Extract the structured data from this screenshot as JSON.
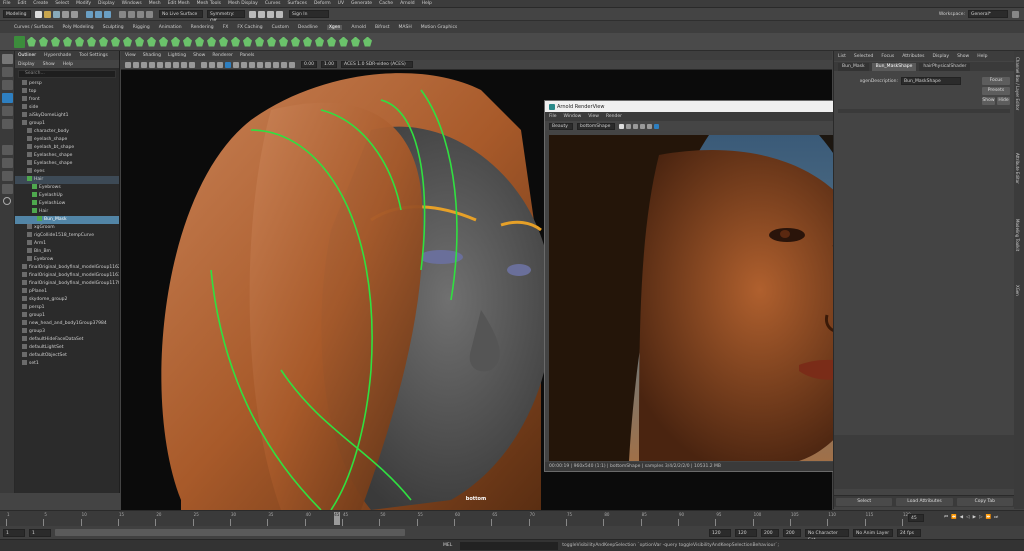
{
  "menubar": {
    "items": [
      "File",
      "Edit",
      "Create",
      "Select",
      "Modify",
      "Display",
      "Windows",
      "Mesh",
      "Edit Mesh",
      "Mesh Tools",
      "Mesh Display",
      "Curves",
      "Surfaces",
      "Deform",
      "UV",
      "Generate",
      "Cache",
      "Arnold",
      "Help"
    ],
    "workspace_label": "Workspace:",
    "workspace_value": "General*"
  },
  "statusline": {
    "mode": "Modeling",
    "live_surface": "No Live Surface",
    "symmetry": "Symmetry: Off",
    "sign_in": "Sign In"
  },
  "shelf": {
    "tabs": [
      "Curves / Surfaces",
      "Poly Modeling",
      "Sculpting",
      "Rigging",
      "Animation",
      "Rendering",
      "FX",
      "FX Caching",
      "Custom",
      "Deadline",
      "Xgen",
      "Arnold",
      "Bifrost",
      "MASH",
      "Motion Graphics"
    ],
    "active_tab": "Xgen"
  },
  "outliner": {
    "tabs": [
      "Outliner",
      "Hypershade",
      "Tool Settings"
    ],
    "menu": [
      "Display",
      "Show",
      "Help"
    ],
    "search_placeholder": "Search...",
    "items": [
      {
        "label": "persp",
        "indent": 1
      },
      {
        "label": "top",
        "indent": 1
      },
      {
        "label": "front",
        "indent": 1
      },
      {
        "label": "side",
        "indent": 1
      },
      {
        "label": "aiSkyDomeLight1",
        "indent": 1
      },
      {
        "label": "group1",
        "indent": 1
      },
      {
        "label": "character_body",
        "indent": 2
      },
      {
        "label": "eyelash_shape",
        "indent": 2
      },
      {
        "label": "eyelash_bt_shape",
        "indent": 2
      },
      {
        "label": "Eyelashes_shape",
        "indent": 2
      },
      {
        "label": "Eyelashes_shape",
        "indent": 2
      },
      {
        "label": "eyes",
        "indent": 2
      },
      {
        "label": "Hair",
        "indent": 2,
        "active": true
      },
      {
        "label": "Eyebrows",
        "indent": 3
      },
      {
        "label": "EyelashUp",
        "indent": 3
      },
      {
        "label": "EyelashLow",
        "indent": 3
      },
      {
        "label": "Hair",
        "indent": 3
      },
      {
        "label": "Bun_Mask",
        "indent": 4,
        "selected": true
      },
      {
        "label": "xgGroom",
        "indent": 2
      },
      {
        "label": "rigCollide1518_tempCurve",
        "indent": 2
      },
      {
        "label": "Arm1",
        "indent": 2
      },
      {
        "label": "Bln_Bm",
        "indent": 2
      },
      {
        "label": "Eyebrow",
        "indent": 2
      },
      {
        "label": "finalOriginal_bodyfinal_modelGroup1162",
        "indent": 1
      },
      {
        "label": "finalOriginal_bodyfinal_modelGroup1163",
        "indent": 1
      },
      {
        "label": "finalOriginal_bodyfinal_modelGroup1170",
        "indent": 1
      },
      {
        "label": "pPlane1",
        "indent": 1
      },
      {
        "label": "skydome_group2",
        "indent": 1
      },
      {
        "label": "persp1",
        "indent": 1
      },
      {
        "label": "group1",
        "indent": 1
      },
      {
        "label": "new_head_and_body1Group37984",
        "indent": 1
      },
      {
        "label": "group3",
        "indent": 1
      },
      {
        "label": "defaultHideFaceDataSet",
        "indent": 1
      },
      {
        "label": "defaultLightSet",
        "indent": 1
      },
      {
        "label": "defaultObjectSet",
        "indent": 1
      },
      {
        "label": "set1",
        "indent": 1
      }
    ]
  },
  "viewport": {
    "menu": [
      "View",
      "Shading",
      "Lighting",
      "Show",
      "Renderer",
      "Panels"
    ],
    "exposure": "0.00",
    "gamma": "1.00",
    "color_space": "ACES 1.0 SDR-video (ACES)",
    "camera_label": "bottom"
  },
  "renderview": {
    "title": "Arnold RenderView",
    "menu": [
      "File",
      "Window",
      "View",
      "Render"
    ],
    "aov": "Beauty",
    "camera": "bottomShape",
    "status": "00:00:19 | 960x540 (1:1) | bottomShape | samples 3/4/2/2/2/0 | 10531.2 MB"
  },
  "attribute_editor": {
    "tabs": [
      "List",
      "Selected",
      "Focus",
      "Attributes",
      "Display",
      "Show",
      "Help"
    ],
    "node_tabs": [
      "Bun_Mask",
      "Bun_MaskShape",
      "hairPhysicalShader"
    ],
    "active_node": "Bun_MaskShape",
    "field_label": "xgenDescription:",
    "field_value": "Bun_MaskShape",
    "buttons": [
      "Focus",
      "Presets",
      "Show",
      "Hide"
    ],
    "bottom": [
      "Select",
      "Load Attributes",
      "Copy Tab"
    ]
  },
  "side_tabs": [
    "Channel Box / Layer Editor",
    "Attribute Editor",
    "Modeling Toolkit",
    "XGen"
  ],
  "timeslider": {
    "ticks": [
      "1",
      "5",
      "10",
      "15",
      "20",
      "25",
      "30",
      "35",
      "40",
      "45",
      "50",
      "55",
      "60",
      "65",
      "70",
      "75",
      "80",
      "85",
      "90",
      "95",
      "100",
      "105",
      "110",
      "115",
      "120"
    ],
    "current_frame": "45",
    "frame_field": "45"
  },
  "rangebar": {
    "start": "1",
    "start_inner": "1",
    "end_inner": "120",
    "end": "120",
    "end2": "200",
    "end3": "200",
    "character_set": "No Character Set",
    "anim_layer": "No Anim Layer",
    "fps": "24 fps"
  },
  "cmdline": {
    "lang": "MEL",
    "text": "toggleVisibilityAndKeepSelection `optionVar -query toggleVisibilityAndKeepSelectionBehaviour`;"
  },
  "colors": {
    "accent": "#5285a6",
    "skin": "#5a5a5a",
    "hair": "#b0632e",
    "guide": "#30e040"
  }
}
